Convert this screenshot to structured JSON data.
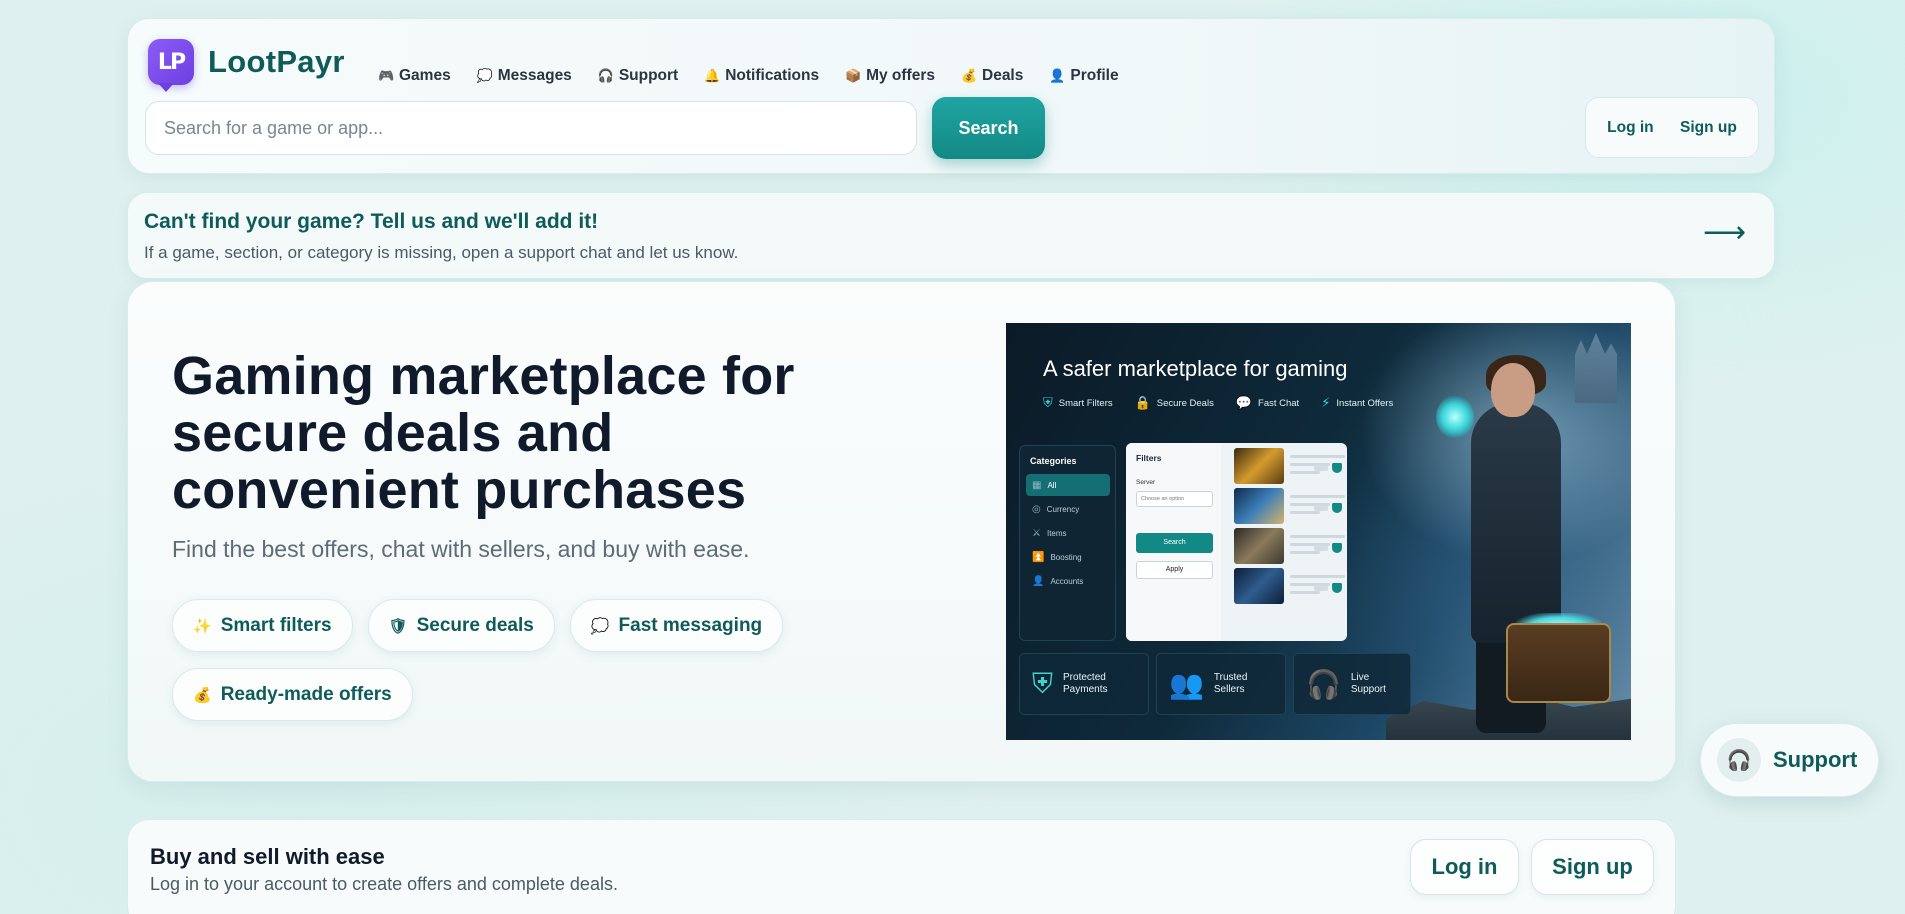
{
  "brand": {
    "logo_mark": "LP",
    "name": "LootPayr",
    "accent": "#0f5b5a",
    "button": "#1a9995",
    "logo_color": "#7c4dea"
  },
  "nav": [
    {
      "label": "Games",
      "icon": "🎮"
    },
    {
      "label": "Messages",
      "icon": "💭"
    },
    {
      "label": "Support",
      "icon": "🎧"
    },
    {
      "label": "Notifications",
      "icon": "🔔"
    },
    {
      "label": "My offers",
      "icon": "📦"
    },
    {
      "label": "Deals",
      "icon": "💰"
    },
    {
      "label": "Profile",
      "icon": "👤"
    }
  ],
  "search": {
    "placeholder": "Search for a game or app...",
    "button": "Search"
  },
  "auth": {
    "login": "Log in",
    "signup": "Sign up"
  },
  "notice": {
    "title": "Can't find your game? Tell us and we'll add it!",
    "text": "If a game, section, or category is missing, open a support chat and let us know.",
    "arrow": "⟶"
  },
  "hero": {
    "title": "Gaming marketplace for secure deals and convenient purchases",
    "subtitle": "Find the best offers, chat with sellers, and buy with ease.",
    "chips": [
      {
        "label": "Smart filters",
        "icon": "✨"
      },
      {
        "label": "Secure deals",
        "icon": "🛡"
      },
      {
        "label": "Fast messaging",
        "icon": "💭"
      },
      {
        "label": "Ready-made offers",
        "icon": "💰"
      }
    ]
  },
  "illustration": {
    "title": "A safer marketplace for gaming",
    "badges": [
      {
        "label": "Smart Filters",
        "icon": "⛨"
      },
      {
        "label": "Secure Deals",
        "icon": "🔒"
      },
      {
        "label": "Fast Chat",
        "icon": "💬"
      },
      {
        "label": "Instant Offers",
        "icon": "⚡"
      }
    ],
    "categories_title": "Categories",
    "categories": [
      {
        "label": "All",
        "icon": "▦"
      },
      {
        "label": "Currency",
        "icon": "◎"
      },
      {
        "label": "Items",
        "icon": "⚔"
      },
      {
        "label": "Boosting",
        "icon": "⏫"
      },
      {
        "label": "Accounts",
        "icon": "👤"
      }
    ],
    "filters_title": "Filters",
    "server_label": "Server",
    "server_placeholder": "Choose an option",
    "search_button": "Search",
    "apply_button": "Apply",
    "features": [
      {
        "label_1": "Protected",
        "label_2": "Payments",
        "icon": "⛨"
      },
      {
        "label_1": "Trusted",
        "label_2": "Sellers",
        "icon": "👥"
      },
      {
        "label_1": "Live",
        "label_2": "Support",
        "icon": "🎧"
      }
    ]
  },
  "support_float": {
    "label": "Support",
    "icon": "🎧"
  },
  "bottom": {
    "title": "Buy and sell with ease",
    "text": "Log in to your account to create offers and complete deals.",
    "login": "Log in",
    "signup": "Sign up"
  }
}
